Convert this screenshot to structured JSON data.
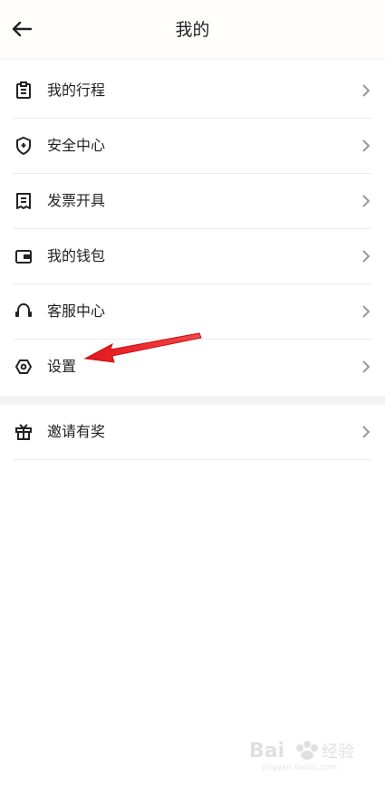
{
  "header": {
    "title": "我的"
  },
  "menu": [
    {
      "label": "我的行程",
      "icon": "itinerary-clipboard-icon"
    },
    {
      "label": "安全中心",
      "icon": "shield-icon"
    },
    {
      "label": "发票开具",
      "icon": "invoice-icon"
    },
    {
      "label": "我的钱包",
      "icon": "wallet-icon"
    },
    {
      "label": "客服中心",
      "icon": "headset-icon"
    },
    {
      "label": "设置",
      "icon": "settings-hexagon-icon"
    }
  ],
  "secondary_menu": [
    {
      "label": "邀请有奖",
      "icon": "gift-icon"
    }
  ],
  "colors": {
    "annotation_arrow": "#e3151a",
    "divider": "#ebebeb",
    "section_gap": "#f3f3f3"
  }
}
